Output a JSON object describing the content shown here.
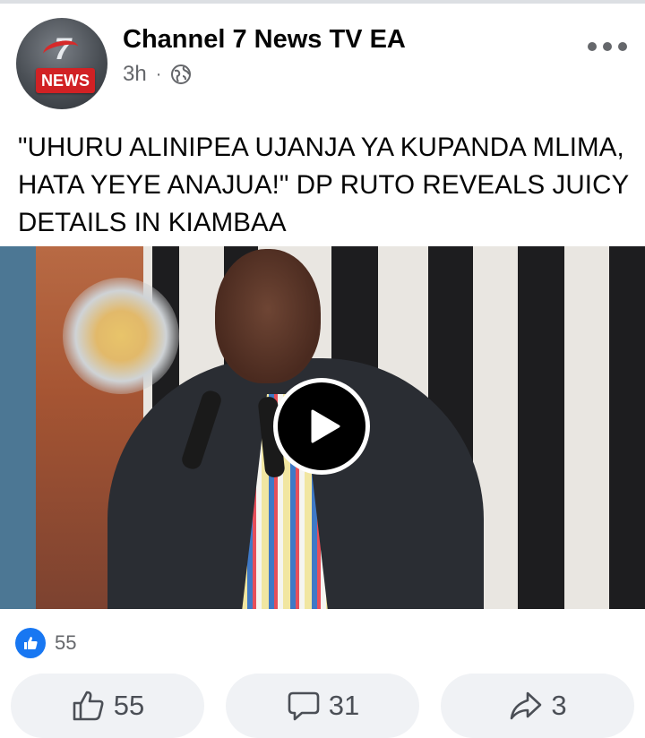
{
  "post": {
    "page_name": "Channel 7 News TV EA",
    "timestamp": "3h",
    "separator": "·",
    "avatar_logo_text": "NEWS",
    "avatar_logo_number": "7",
    "headline": "\"UHURU ALINIPEA UJANJA YA KUPANDA MLIMA, HATA YEYE ANAJUA!\" DP RUTO REVEALS JUICY DETAILS IN KIAMBAA"
  },
  "reactions": {
    "icon": "like-icon",
    "count": "55"
  },
  "actions": {
    "like": {
      "icon": "thumbs-up-icon",
      "count": "55"
    },
    "comment": {
      "icon": "comment-bubble-icon",
      "count": "31"
    },
    "share": {
      "icon": "share-arrow-icon",
      "count": "3"
    }
  },
  "colors": {
    "brand_blue": "#1877f2",
    "secondary_text": "#65676b",
    "button_bg": "#f0f2f5",
    "logo_red": "#d12124"
  }
}
